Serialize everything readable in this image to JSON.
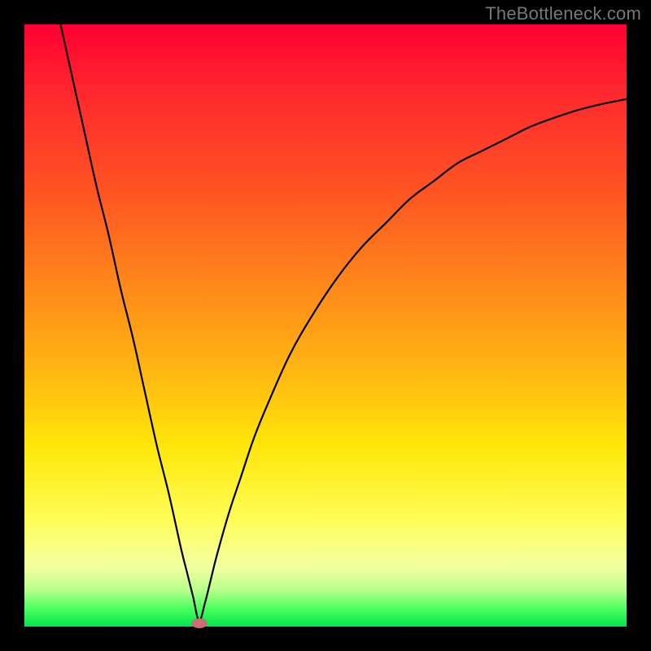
{
  "watermark": "TheBottleneck.com",
  "chart_data": {
    "type": "line",
    "title": "",
    "xlabel": "",
    "ylabel": "",
    "xlim": [
      0,
      100
    ],
    "ylim": [
      0,
      100
    ],
    "grid": false,
    "legend": false,
    "marker": {
      "x": 29,
      "y": 0.5
    },
    "series": [
      {
        "name": "bottleneck-curve",
        "x": [
          6,
          8,
          10,
          12,
          14,
          16,
          18,
          20,
          22,
          24,
          26,
          27,
          28,
          29,
          30,
          31,
          32,
          34,
          36,
          38,
          40,
          44,
          48,
          52,
          56,
          60,
          64,
          68,
          72,
          76,
          80,
          84,
          88,
          92,
          96,
          100
        ],
        "y": [
          100,
          91,
          82,
          73,
          65,
          56,
          48,
          39,
          30,
          22,
          13,
          9,
          5,
          1,
          4,
          8,
          12,
          19,
          25,
          31,
          36,
          45,
          52,
          58,
          63,
          67,
          71,
          74,
          77,
          79,
          81,
          83,
          84.5,
          85.8,
          86.8,
          87.6
        ]
      }
    ],
    "background_gradient": {
      "stops": [
        {
          "pos": 0,
          "color": "#ff0033"
        },
        {
          "pos": 12,
          "color": "#ff2a2d"
        },
        {
          "pos": 28,
          "color": "#ff5522"
        },
        {
          "pos": 44,
          "color": "#ff8a1a"
        },
        {
          "pos": 58,
          "color": "#ffb812"
        },
        {
          "pos": 70,
          "color": "#ffe60a"
        },
        {
          "pos": 82,
          "color": "#fffd55"
        },
        {
          "pos": 90,
          "color": "#f4ffa0"
        },
        {
          "pos": 94,
          "color": "#b6ff8a"
        },
        {
          "pos": 97,
          "color": "#4cff60"
        },
        {
          "pos": 100,
          "color": "#00e64d"
        }
      ]
    }
  }
}
